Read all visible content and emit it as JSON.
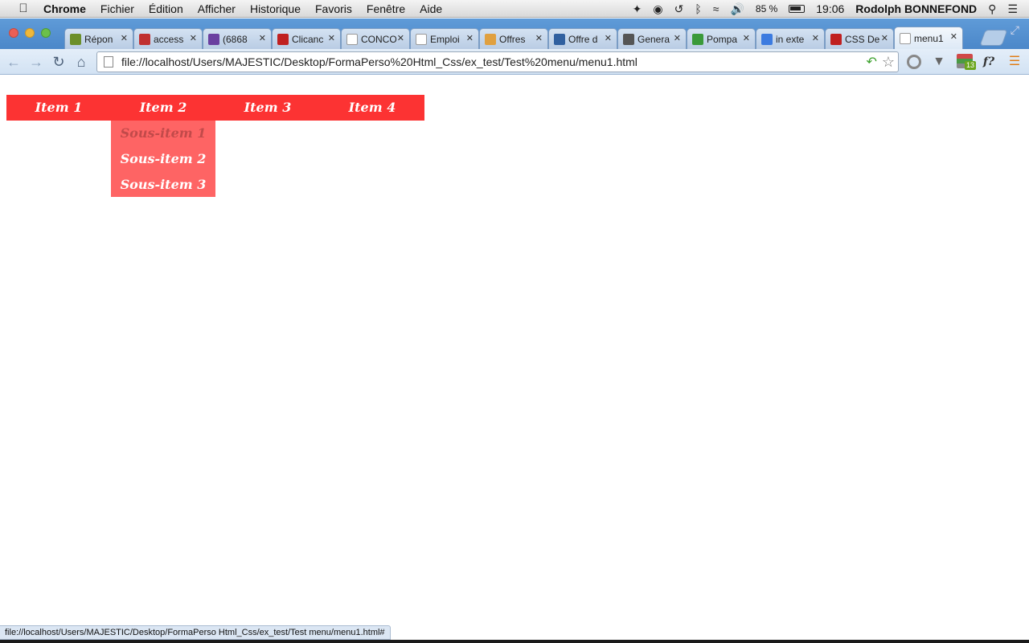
{
  "menubar": {
    "app": "Chrome",
    "menus": [
      "Fichier",
      "Édition",
      "Afficher",
      "Historique",
      "Favoris",
      "Fenêtre",
      "Aide"
    ],
    "battery": "85 %",
    "time": "19:06",
    "user": "Rodolph BONNEFOND"
  },
  "tabs": [
    {
      "title": "Répon",
      "icon": "puzzle-icon",
      "color": "#6b8f2a"
    },
    {
      "title": "access",
      "icon": "search-icon",
      "color": "#c03030"
    },
    {
      "title": "(6868",
      "icon": "mail-icon",
      "color": "#6a3fa0"
    },
    {
      "title": "Clicanc",
      "icon": "app-icon",
      "color": "#c02020"
    },
    {
      "title": "CONCO",
      "icon": "page-icon",
      "color": "#ffffff"
    },
    {
      "title": "Emploi",
      "icon": "page-icon",
      "color": "#ffffff"
    },
    {
      "title": "Offres",
      "icon": "site-icon",
      "color": "#e0a040"
    },
    {
      "title": "Offre d",
      "icon": "site-icon",
      "color": "#3060a0"
    },
    {
      "title": "Genera",
      "icon": "gear-icon",
      "color": "#555555"
    },
    {
      "title": "Pompa",
      "icon": "site-icon",
      "color": "#3a9a3a"
    },
    {
      "title": "in exte",
      "icon": "google-icon",
      "color": "#3c7be0"
    },
    {
      "title": "CSS De",
      "icon": "hash-icon",
      "color": "#c02020"
    },
    {
      "title": "menu1",
      "icon": "page-icon",
      "color": "#ffffff",
      "active": true
    }
  ],
  "toolbar": {
    "url": "file://localhost/Users/MAJESTIC/Desktop/FormaPerso%20Html_Css/ex_test/Test%20menu/menu1.html",
    "ext_badge": "13",
    "ext_label": "f?"
  },
  "page": {
    "nav": [
      "Item 1",
      "Item 2",
      "Item 3",
      "Item 4"
    ],
    "submenu": [
      "Sous-item 1",
      "Sous-item 2",
      "Sous-item 3"
    ],
    "colors": {
      "nav_bg": "#fc3333",
      "submenu_bg": "#fe6464",
      "hover_text": "#c24a4a"
    }
  },
  "status": "file://localhost/Users/MAJESTIC/Desktop/FormaPerso Html_Css/ex_test/Test menu/menu1.html#"
}
